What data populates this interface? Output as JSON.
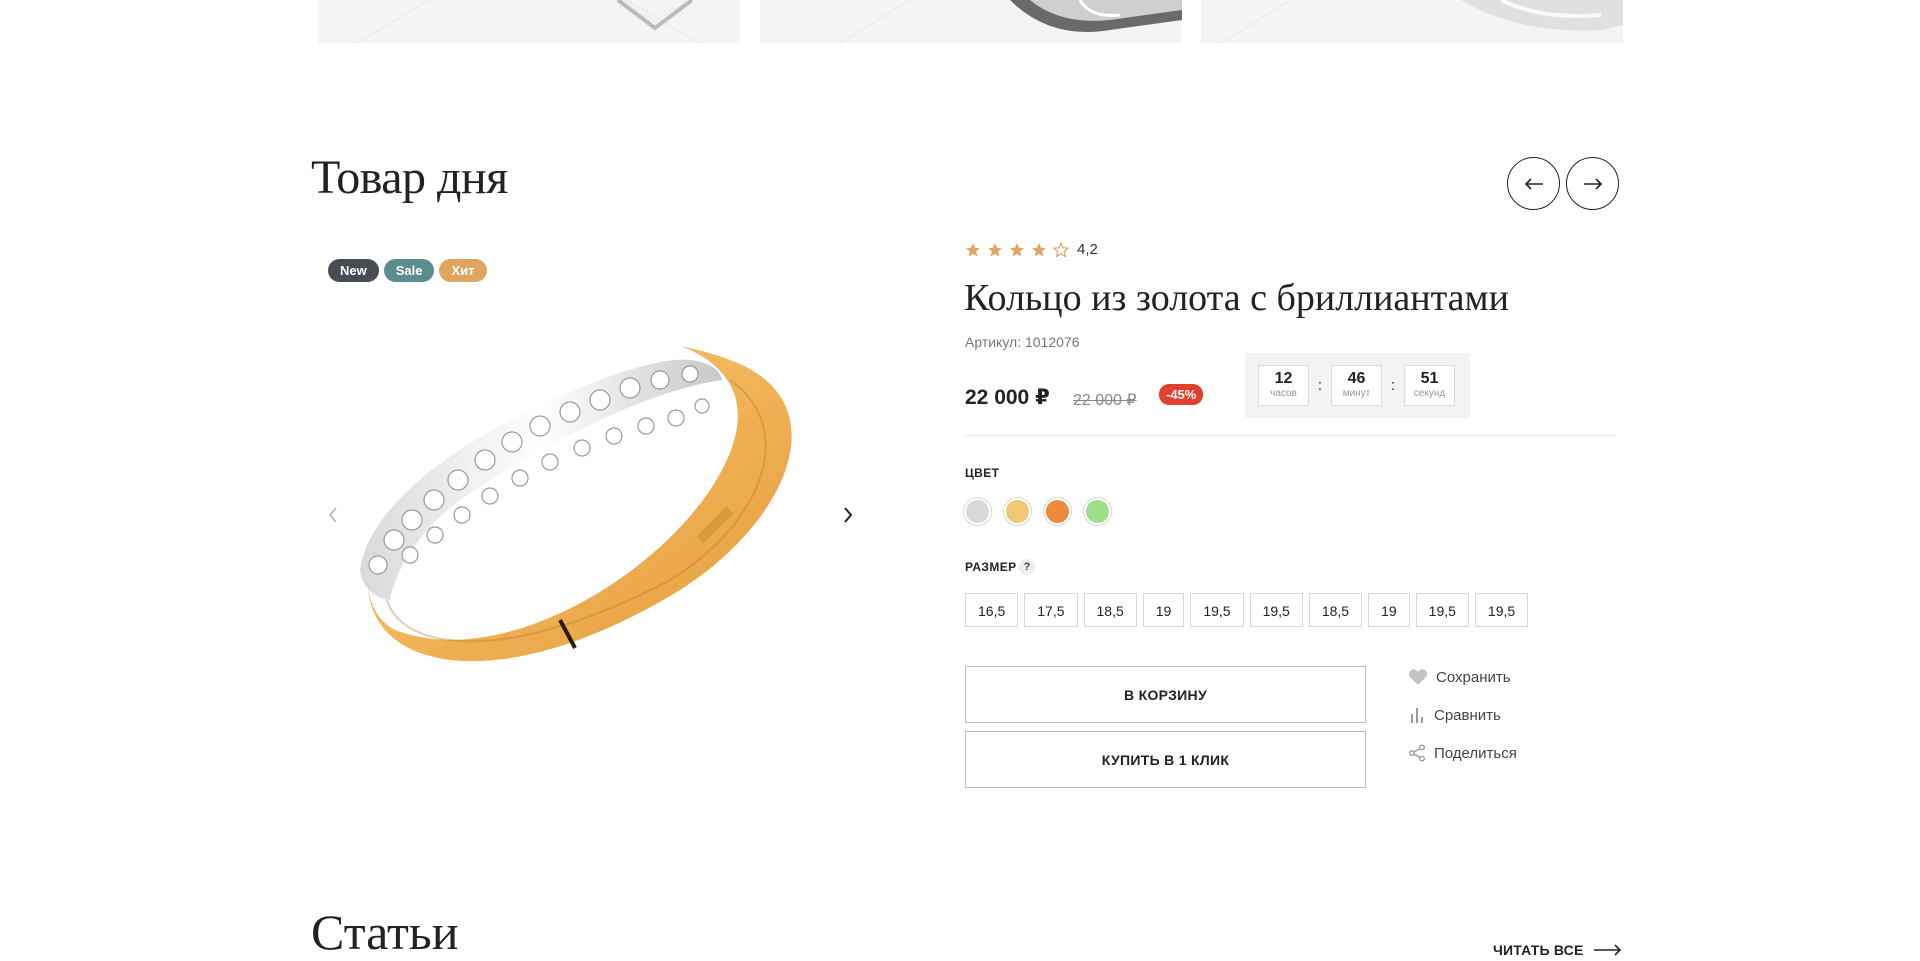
{
  "top_cards": [
    {
      "name": "top-card-necklace"
    },
    {
      "name": "top-card-ring-dark"
    },
    {
      "name": "top-card-ring-light"
    }
  ],
  "section_title": "Товар дня",
  "nav": {
    "prev_icon": "arrow-left-icon",
    "next_icon": "arrow-right-icon"
  },
  "badges": [
    {
      "label": "New",
      "color": "#474b54"
    },
    {
      "label": "Sale",
      "color": "#5c8d8e"
    },
    {
      "label": "Хит",
      "color": "#e0a660"
    }
  ],
  "product": {
    "rating": {
      "value": "4,2",
      "stars_filled": 4,
      "stars_total": 5,
      "star_color": "#e0a660"
    },
    "title": "Кольцо из золота с бриллиантами",
    "sku": "Артикул: 1012076",
    "price": "22 000 ₽",
    "old_price": "22 000 ₽",
    "discount": "-45%",
    "timer": [
      {
        "value": "12",
        "label": "часов"
      },
      {
        "value": "46",
        "label": "минут"
      },
      {
        "value": "51",
        "label": "секунд"
      }
    ],
    "timer_separator": ":",
    "color_label": "ЦВЕТ",
    "colors": [
      "#d9d9d9",
      "#f2c772",
      "#ee8a3e",
      "#9ee08a"
    ],
    "size_label": "РАЗМЕР",
    "size_help": "?",
    "sizes": [
      "16,5",
      "17,5",
      "18,5",
      "19",
      "19,5",
      "19,5",
      "18,5",
      "19",
      "19,5",
      "19,5"
    ],
    "cart_button": "В КОРЗИНУ",
    "one_click_button": "КУПИТЬ В 1 КЛИК",
    "actions": {
      "save": "Сохранить",
      "compare": "Сравнить",
      "share": "Поделиться"
    }
  },
  "articles": {
    "title": "Статьи",
    "read_all": "ЧИТАТЬ ВСЕ"
  }
}
